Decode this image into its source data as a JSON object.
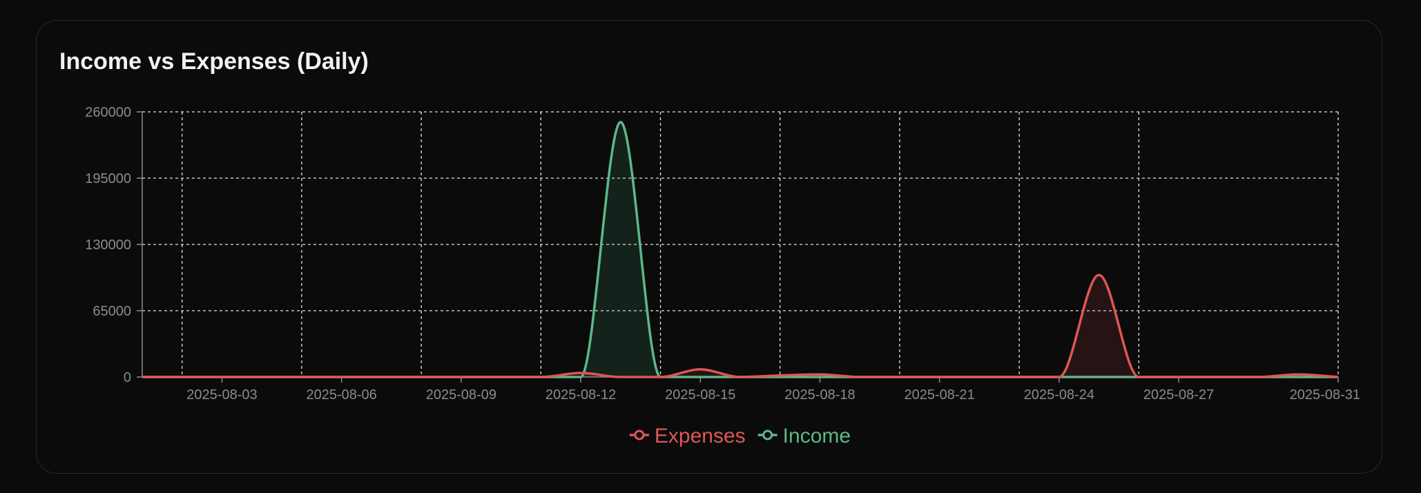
{
  "card": {
    "title": "Income vs Expenses (Daily)"
  },
  "colors": {
    "background": "#0b0b0b",
    "card_border": "#2a2a2a",
    "grid": "#e6e6e6",
    "axis_text": "#8c8c8c",
    "expenses": "#e05656",
    "income": "#5bb88a"
  },
  "chart_data": {
    "type": "line",
    "title": "",
    "xlabel": "",
    "ylabel": "",
    "ylim": [
      0,
      260000
    ],
    "yticks": [
      0,
      65000,
      130000,
      195000,
      260000
    ],
    "grid": true,
    "legend_position": "bottom",
    "xlim": [
      "2025-08-01",
      "2025-08-31"
    ],
    "xticks": [
      "2025-08-03",
      "2025-08-06",
      "2025-08-09",
      "2025-08-12",
      "2025-08-15",
      "2025-08-18",
      "2025-08-21",
      "2025-08-24",
      "2025-08-27",
      "2025-08-31"
    ],
    "x": [
      "2025-08-01",
      "2025-08-02",
      "2025-08-03",
      "2025-08-04",
      "2025-08-05",
      "2025-08-06",
      "2025-08-07",
      "2025-08-08",
      "2025-08-09",
      "2025-08-10",
      "2025-08-11",
      "2025-08-12",
      "2025-08-13",
      "2025-08-14",
      "2025-08-15",
      "2025-08-16",
      "2025-08-17",
      "2025-08-18",
      "2025-08-19",
      "2025-08-20",
      "2025-08-21",
      "2025-08-22",
      "2025-08-23",
      "2025-08-24",
      "2025-08-25",
      "2025-08-26",
      "2025-08-27",
      "2025-08-28",
      "2025-08-29",
      "2025-08-30",
      "2025-08-31"
    ],
    "series": [
      {
        "name": "Expenses",
        "color": "#e05656",
        "values": [
          0,
          0,
          0,
          0,
          0,
          0,
          0,
          0,
          0,
          0,
          0,
          4000,
          0,
          0,
          7500,
          0,
          1500,
          2500,
          0,
          0,
          0,
          0,
          0,
          0,
          100000,
          0,
          0,
          0,
          0,
          2500,
          0
        ]
      },
      {
        "name": "Income",
        "color": "#5bb88a",
        "values": [
          0,
          0,
          0,
          0,
          0,
          0,
          0,
          0,
          0,
          0,
          0,
          0,
          250000,
          0,
          0,
          0,
          0,
          0,
          0,
          0,
          0,
          0,
          0,
          0,
          0,
          0,
          0,
          0,
          0,
          0,
          0
        ]
      }
    ]
  }
}
